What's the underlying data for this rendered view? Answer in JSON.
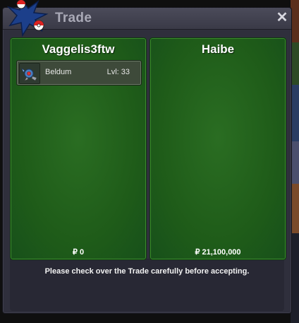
{
  "window": {
    "title": "Trade",
    "close_symbol": "✕"
  },
  "players": [
    {
      "name": "Vaggelis3ftw",
      "items": [
        {
          "name": "Beldum",
          "level": "Lvl: 33",
          "icon": "beldum-icon"
        }
      ],
      "money": "₽ 0"
    },
    {
      "name": "Haibe",
      "items": [],
      "money": "₽ 21,100,000"
    }
  ],
  "notice": "Please check over the Trade carefully before accepting.",
  "colors": {
    "panel_green": "#1f5c19",
    "window_bg": "#2f2f3c",
    "title_text": "#a9a9b6"
  }
}
